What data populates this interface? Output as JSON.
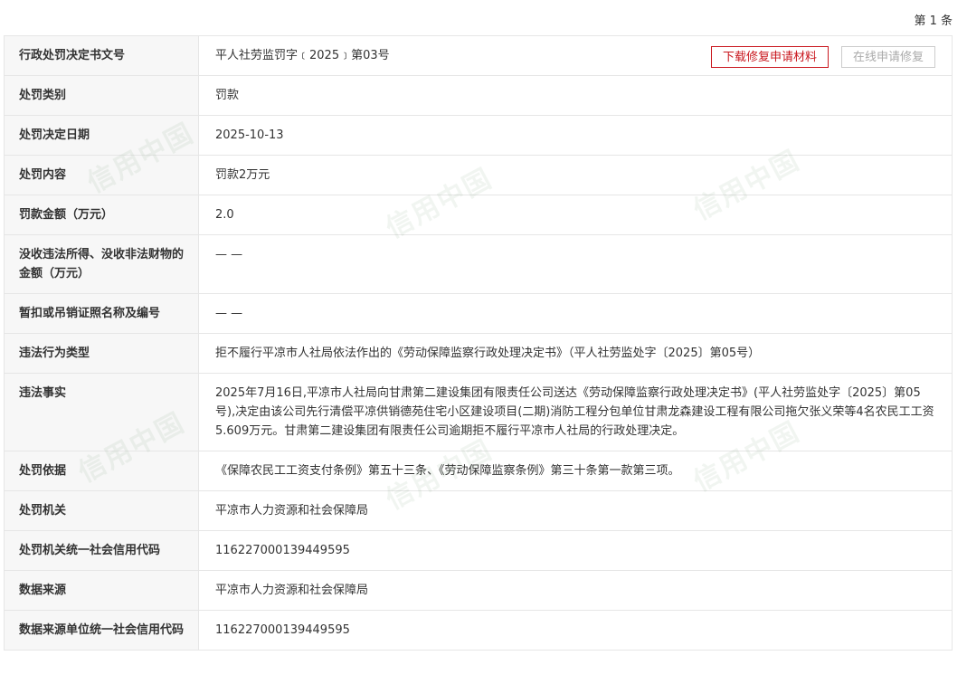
{
  "header": {
    "count_label": "第 1 条"
  },
  "actions": {
    "download_label": "下载修复申请材料",
    "online_label": "在线申请修复"
  },
  "watermark": {
    "text": "信用中国"
  },
  "rows": [
    {
      "label": "行政处罚决定书文号",
      "value": "平人社劳监罚字﹝2025﹞第03号"
    },
    {
      "label": "处罚类别",
      "value": "罚款"
    },
    {
      "label": "处罚决定日期",
      "value": "2025-10-13"
    },
    {
      "label": "处罚内容",
      "value": "罚款2万元"
    },
    {
      "label": "罚款金额（万元）",
      "value": "2.0"
    },
    {
      "label": "没收违法所得、没收非法财物的金额（万元）",
      "value": "— —"
    },
    {
      "label": "暂扣或吊销证照名称及编号",
      "value": "— —"
    },
    {
      "label": "违法行为类型",
      "value": "拒不履行平凉市人社局依法作出的《劳动保障监察行政处理决定书》（平人社劳监处字〔2025〕第05号）"
    },
    {
      "label": "违法事实",
      "value": "2025年7月16日,平凉市人社局向甘肃第二建设集团有限责任公司送达《劳动保障监察行政处理决定书》(平人社劳监处字〔2025〕第05号),决定由该公司先行清偿平凉供销德苑住宅小区建设项目(二期)消防工程分包单位甘肃龙森建设工程有限公司拖欠张义荣等4名农民工工资5.609万元。甘肃第二建设集团有限责任公司逾期拒不履行平凉市人社局的行政处理决定。"
    },
    {
      "label": "处罚依据",
      "value": "《保障农民工工资支付条例》第五十三条、《劳动保障监察条例》第三十条第一款第三项。"
    },
    {
      "label": "处罚机关",
      "value": "平凉市人力资源和社会保障局"
    },
    {
      "label": "处罚机关统一社会信用代码",
      "value": "116227000139449595"
    },
    {
      "label": "数据来源",
      "value": "平凉市人力资源和社会保障局"
    },
    {
      "label": "数据来源单位统一社会信用代码",
      "value": "116227000139449595"
    }
  ]
}
